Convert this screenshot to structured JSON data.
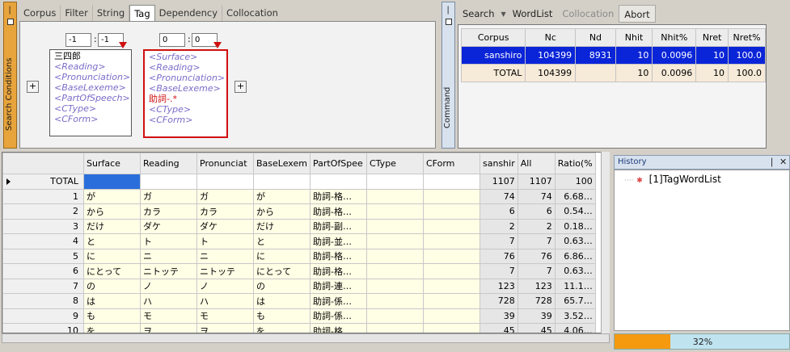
{
  "search_panel": {
    "label": "Search Conditions",
    "tabs": [
      "Corpus",
      "Filter",
      "String",
      "Tag",
      "Dependency",
      "Collocation"
    ],
    "active_tab": "Tag",
    "unit1": {
      "range_from": "-1",
      "range_to": "-1",
      "lines": [
        "三四郎",
        "<Reading>",
        "<Pronunciation>",
        "<BaseLexeme>",
        "<PartOfSpeech>",
        "<CType>",
        "<CForm>"
      ]
    },
    "unit2": {
      "range_from": "0",
      "range_to": "0",
      "lines": [
        "<Surface>",
        "<Reading>",
        "<Pronunciation>",
        "<BaseLexeme>",
        "助詞-.*",
        "<CType>",
        "<CForm>"
      ]
    },
    "plus": "+"
  },
  "command_panel": {
    "label": "Command"
  },
  "toolbar": {
    "search": "Search",
    "wordlist": "WordList",
    "collocation": "Collocation",
    "abort": "Abort"
  },
  "wordlist_table": {
    "headers": [
      "Corpus",
      "Nc",
      "Nd",
      "Nhit",
      "Nhit%",
      "Nret",
      "Nret%"
    ],
    "rows": [
      [
        "sanshiro",
        "104399",
        "8931",
        "10",
        "0.0096",
        "10",
        "100.0"
      ],
      [
        "TOTAL",
        "104399",
        "",
        "10",
        "0.0096",
        "10",
        "100.0"
      ]
    ]
  },
  "grid": {
    "headers": [
      "",
      "Surface",
      "Reading",
      "Pronunciat",
      "BaseLexem",
      "PartOfSpee",
      "CType",
      "CForm",
      "sanshir",
      "All",
      "Ratio(%"
    ],
    "rows": [
      [
        "TOTAL",
        "",
        "",
        "",
        "",
        "",
        "",
        "",
        "1107",
        "1107",
        "100"
      ],
      [
        "1",
        "が",
        "ガ",
        "ガ",
        "が",
        "助詞-格…",
        "",
        "",
        "74",
        "74",
        "6.68…"
      ],
      [
        "2",
        "から",
        "カラ",
        "カラ",
        "から",
        "助詞-格…",
        "",
        "",
        "6",
        "6",
        "0.54…"
      ],
      [
        "3",
        "だけ",
        "ダケ",
        "ダケ",
        "だけ",
        "助詞-副…",
        "",
        "",
        "2",
        "2",
        "0.18…"
      ],
      [
        "4",
        "と",
        "ト",
        "ト",
        "と",
        "助詞-並…",
        "",
        "",
        "7",
        "7",
        "0.63…"
      ],
      [
        "5",
        "に",
        "ニ",
        "ニ",
        "に",
        "助詞-格…",
        "",
        "",
        "76",
        "76",
        "6.86…"
      ],
      [
        "6",
        "にとって",
        "ニトッテ",
        "ニトッテ",
        "にとって",
        "助詞-格…",
        "",
        "",
        "7",
        "7",
        "0.63…"
      ],
      [
        "7",
        "の",
        "ノ",
        "ノ",
        "の",
        "助詞-連…",
        "",
        "",
        "123",
        "123",
        "11.1…"
      ],
      [
        "8",
        "は",
        "ハ",
        "ハ",
        "は",
        "助詞-係…",
        "",
        "",
        "728",
        "728",
        "65.7…"
      ],
      [
        "9",
        "も",
        "モ",
        "モ",
        "も",
        "助詞-係…",
        "",
        "",
        "39",
        "39",
        "3.52…"
      ],
      [
        "10",
        "を",
        "ヲ",
        "ヲ",
        "を",
        "助詞-格…",
        "",
        "",
        "45",
        "45",
        "4.06…"
      ]
    ]
  },
  "history": {
    "title": "History",
    "items": [
      "[1]TagWordList"
    ]
  },
  "progress": {
    "value": 0.32,
    "label": "32%"
  },
  "colors": {
    "selection": "#0a24d8",
    "accent_orange": "#f59a0e",
    "red": "#d01010"
  }
}
